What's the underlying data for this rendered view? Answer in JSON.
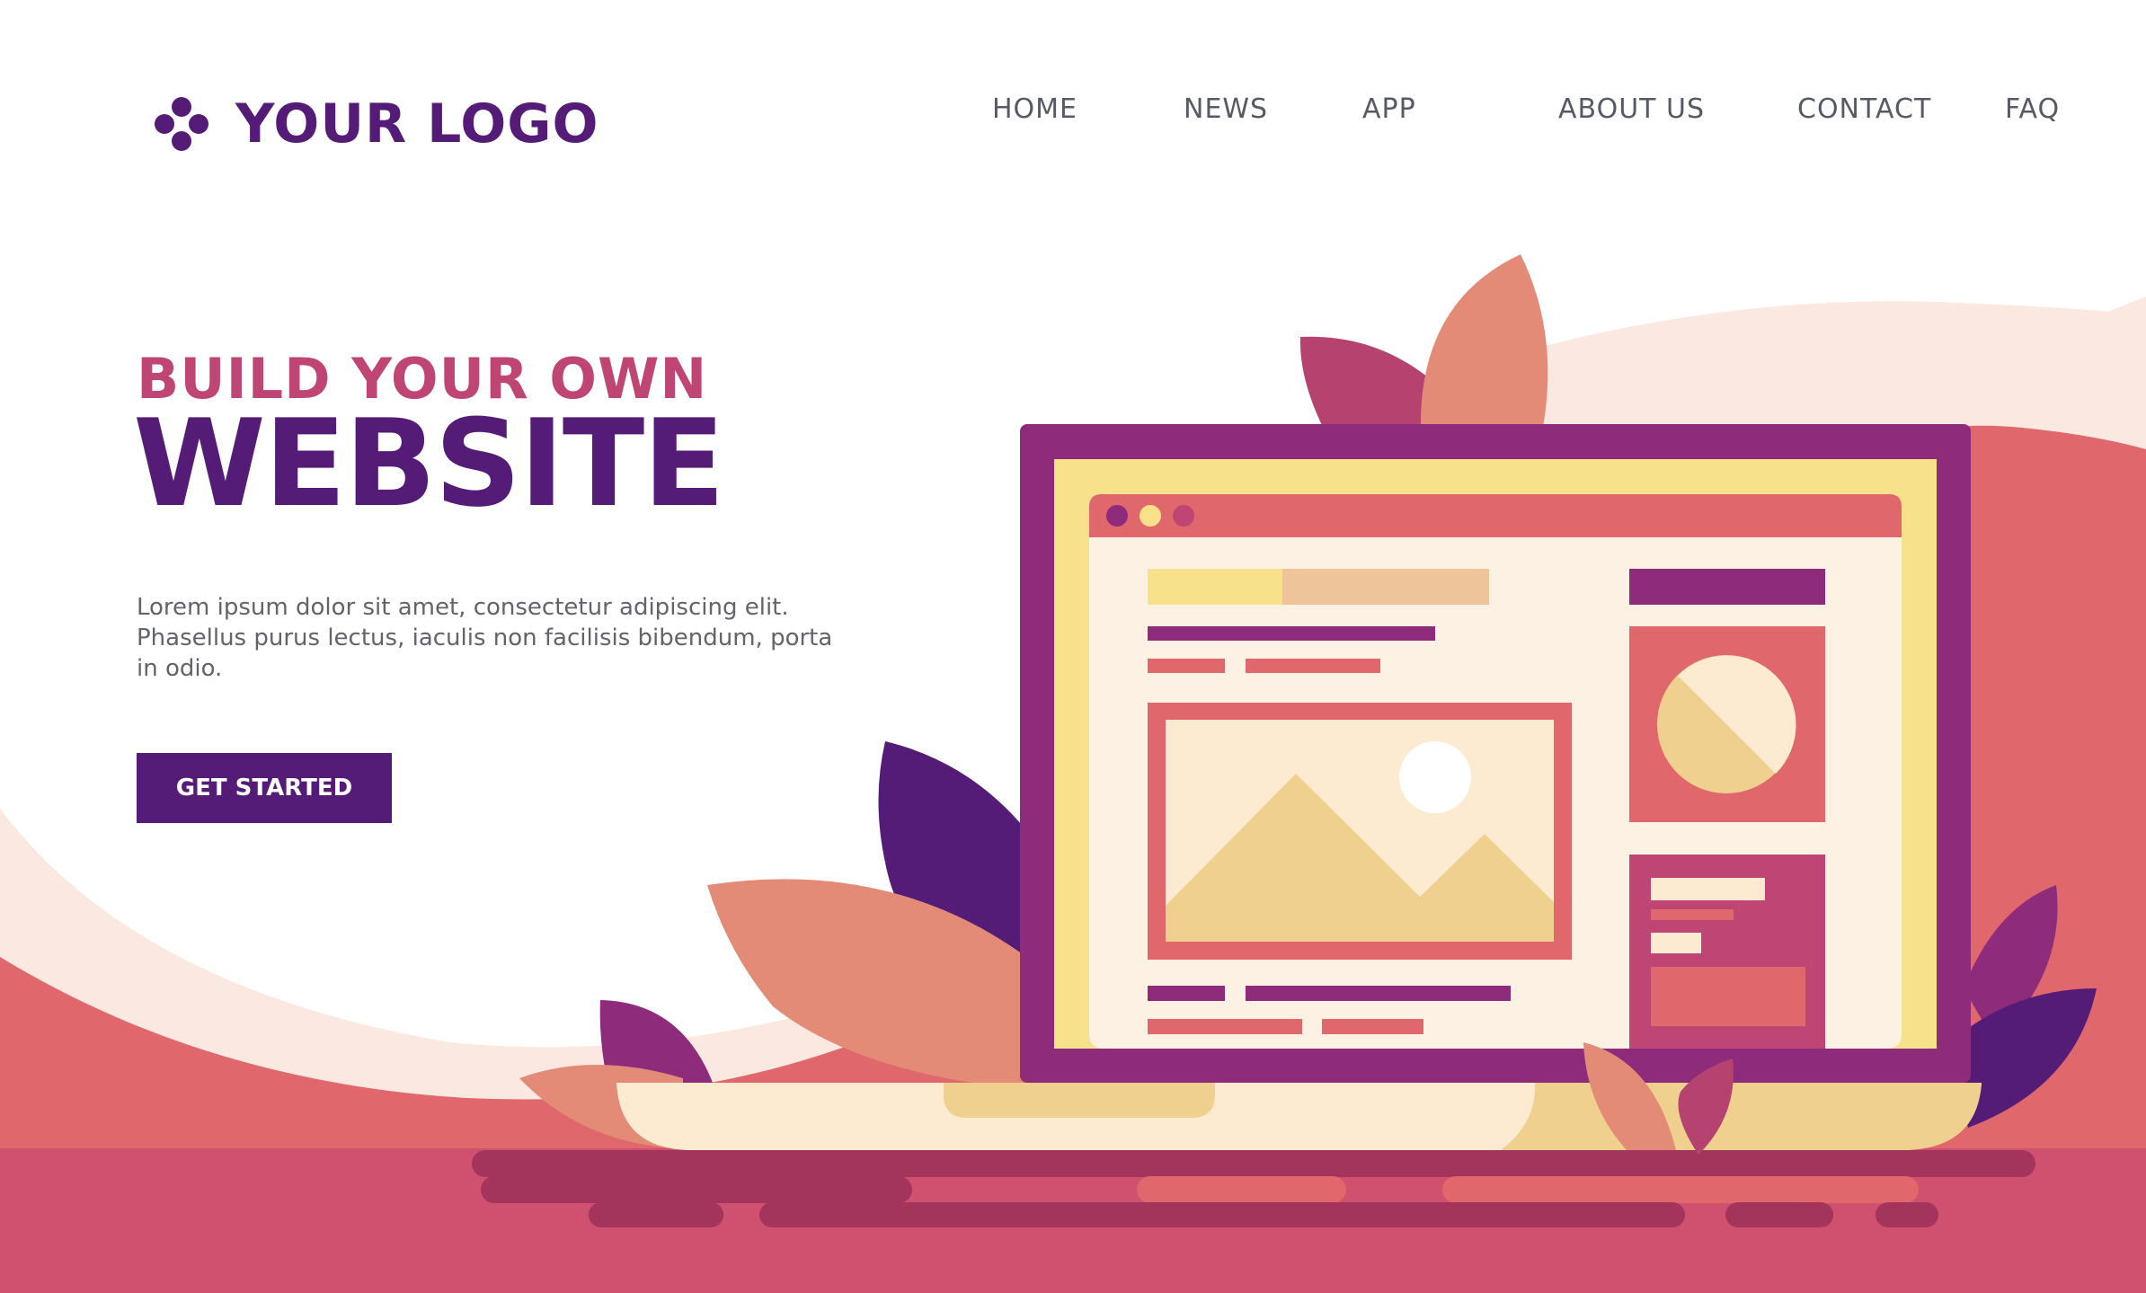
{
  "brand": {
    "logo_text": "YOUR LOGO"
  },
  "nav": {
    "items": [
      "HOME",
      "NEWS",
      "APP",
      "ABOUT US",
      "CONTACT",
      "FAQ"
    ]
  },
  "hero": {
    "kicker": "BUILD YOUR OWN",
    "title": "WEBSITE",
    "body": "Lorem ipsum dolor sit amet, consectetur adipiscing elit. Phasellus purus lectus, iaculis non facilisis bibendum, porta in odio.",
    "cta_label": "GET STARTED"
  },
  "icons": {
    "logo_mark": "four-dot-flower-icon",
    "illustration": "laptop-with-webpage-mockup",
    "image_placeholder": "mountain-sun-image-icon",
    "chart_placeholder": "pie-chart-icon"
  },
  "colors": {
    "primary_purple": "#541c76",
    "magenta": "#8e2b7a",
    "pink": "#bf4574",
    "coral": "#e0676c",
    "salmon": "#e38b77",
    "peach": "#fbe8e0",
    "yellow": "#f7e18a",
    "cream": "#fcebd0",
    "sand": "#f0d08f",
    "ground": "#cf506f",
    "ground_dark": "#a3345c"
  }
}
